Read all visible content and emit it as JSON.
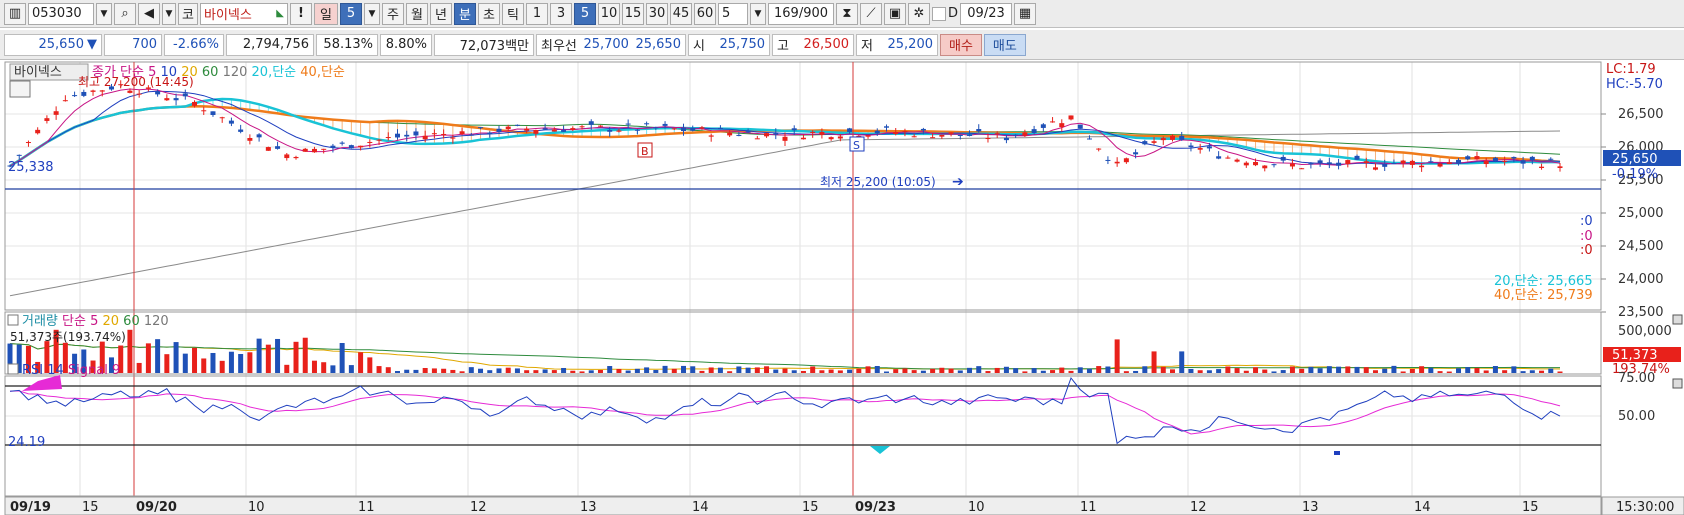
{
  "toolbar": {
    "code": "053030",
    "market": "코",
    "name": "바이넥스",
    "exclaim": "!",
    "period_day": "일",
    "period_num": "5",
    "periods": [
      "주",
      "월",
      "년",
      "분",
      "초",
      "틱"
    ],
    "intervals": [
      "1",
      "3",
      "5",
      "10",
      "15",
      "30",
      "45",
      "60"
    ],
    "interval_sel": "5",
    "count": "169",
    "count_total": "/900",
    "d_label": "D",
    "date": "09/23"
  },
  "quote": {
    "price": "25,650",
    "arrow": "▼",
    "change": "700",
    "change_pct": "-2.66%",
    "volume": "2,794,756",
    "vol_ratio": "58.13%",
    "turnover": "8.80%",
    "amount": "72,073백만",
    "best_label": "최우선",
    "best_ask": "25,700",
    "best_bid": "25,650",
    "open_label": "시",
    "open": "25,750",
    "high_label": "고",
    "high": "26,500",
    "low_label": "저",
    "low": "25,200",
    "buy": "매수",
    "sell": "매도"
  },
  "price_panel": {
    "name_tag": "바이넥스",
    "legend": [
      {
        "text": "종가 단순 5",
        "color": "#c71585"
      },
      {
        "text": "10",
        "color": "#1f3fbf"
      },
      {
        "text": "20",
        "color": "#e0a800"
      },
      {
        "text": "60",
        "color": "#2e8b3d"
      },
      {
        "text": "120",
        "color": "#777777"
      },
      {
        "text": "20,단순",
        "color": "#19c3d6"
      },
      {
        "text": "40,단순",
        "color": "#ef7b1a"
      }
    ],
    "high_note": "최고 27,200 (14:45)",
    "low_note": "최저 25,200 (10:05)",
    "left_value": "25,338",
    "lc": "LC:1.79",
    "hc": "HC:-5.70",
    "price_ticks": [
      "26,500",
      "26,000",
      "25,500",
      "25,000",
      "24,500",
      "24,000",
      "23,500"
    ],
    "current": "25,650",
    "current_pct": "-0.19%",
    "colon_vals": [
      ":0",
      ":0",
      ":0"
    ],
    "ma_bottom1": "20,단순: 25,665",
    "ma_bottom2": "40,단순: 25,739",
    "b_marker": "B",
    "s_marker": "S"
  },
  "volume_panel": {
    "legend": [
      {
        "text": "거래량",
        "color": "#1f8fa6"
      },
      {
        "text": "단순 5",
        "color": "#c71585"
      },
      {
        "text": "20",
        "color": "#e0a800"
      },
      {
        "text": "60",
        "color": "#2e8b3d"
      },
      {
        "text": "120",
        "color": "#777777"
      }
    ],
    "note": "51,373주(193.74%)",
    "tick": "500,000",
    "current": "51,373",
    "current_pct": "193.74%"
  },
  "rsi_panel": {
    "legend": [
      {
        "text": "RSI 14",
        "color": "#1f3fbf"
      },
      {
        "text": "Signal 9",
        "color": "#c71585"
      }
    ],
    "left_value": "24.19",
    "ticks": [
      "75.00",
      "50.00"
    ]
  },
  "time_axis": {
    "labels": [
      "09/19",
      "15",
      "09/20",
      "10",
      "11",
      "12",
      "13",
      "14",
      "15",
      "09/23",
      "10",
      "11",
      "12",
      "13",
      "14",
      "15"
    ],
    "clock": "15:30:00"
  },
  "colors": {
    "up": "#e8211b",
    "down": "#1f51b7",
    "cloud": "#6fe3f0",
    "ma40": "#ef7b1a",
    "accent": "#2a5fbf"
  }
}
